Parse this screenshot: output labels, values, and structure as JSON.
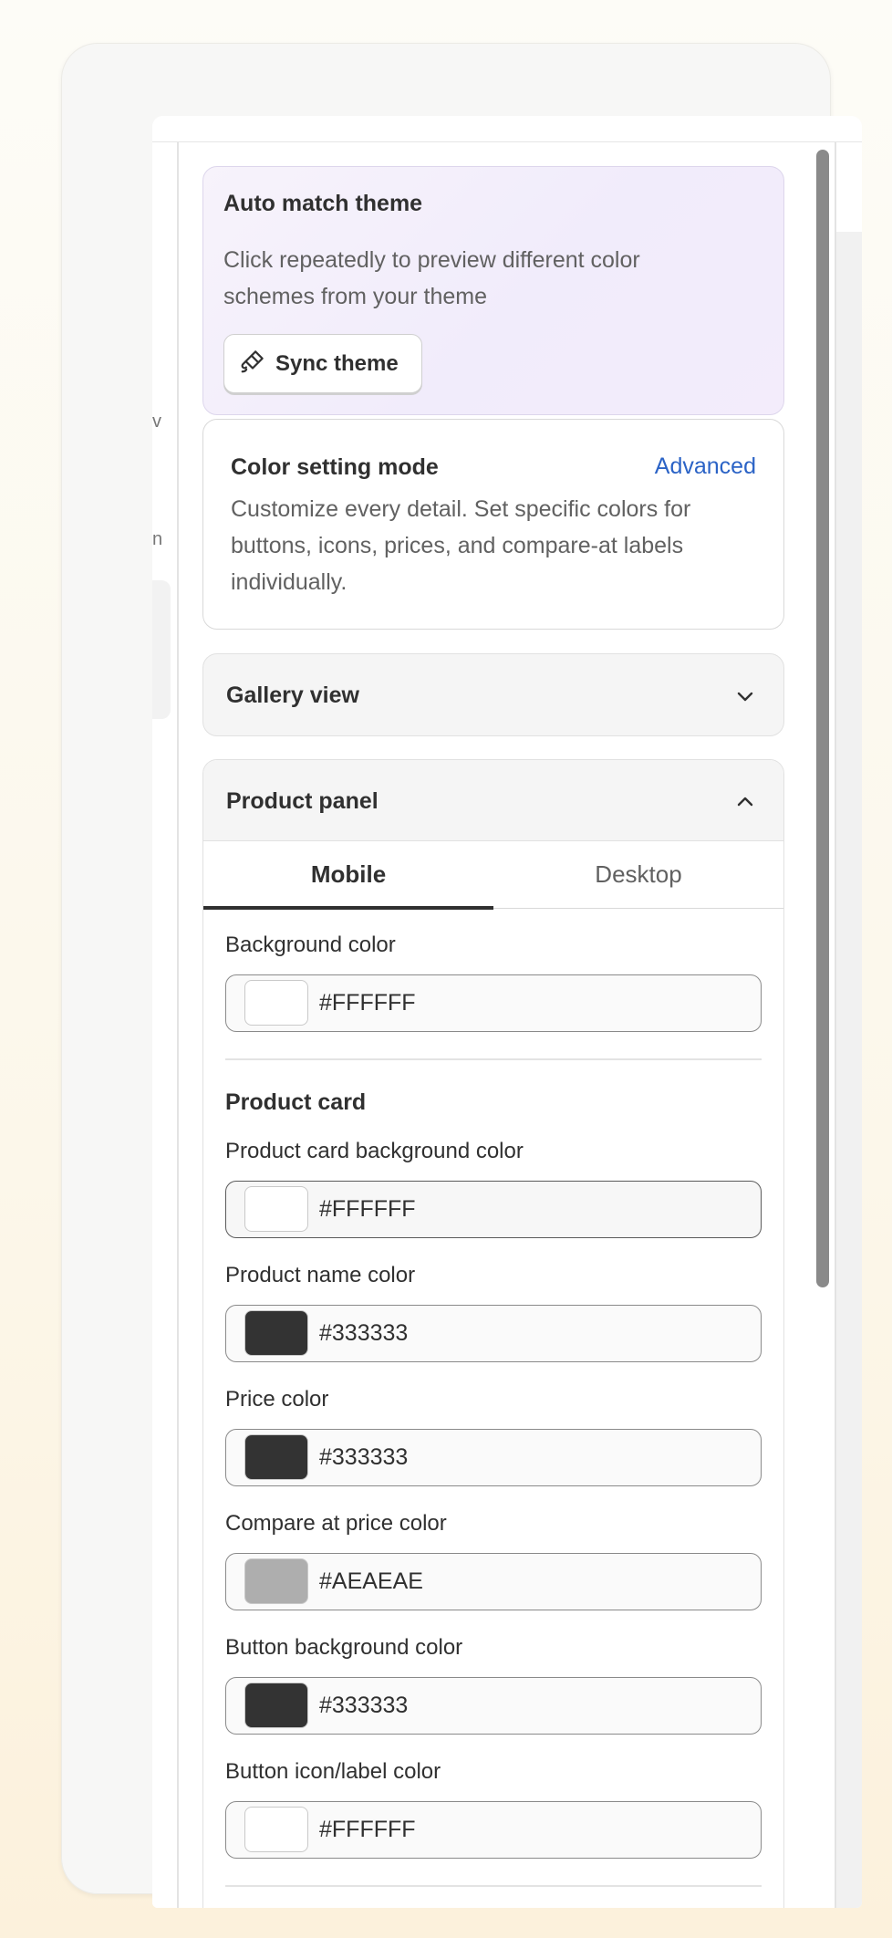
{
  "sidebar_fragments": {
    "item1": "v",
    "item2": "n"
  },
  "auto_match": {
    "title": "Auto match theme",
    "description": "Click repeatedly to preview different color schemes from your theme",
    "button_label": "Sync theme"
  },
  "color_mode": {
    "title": "Color setting mode",
    "link": "Advanced",
    "description": "Customize every detail. Set specific colors for buttons, icons, prices, and compare-at labels individually."
  },
  "gallery": {
    "title": "Gallery view",
    "expanded": false
  },
  "product_panel": {
    "title": "Product panel",
    "expanded": true,
    "tabs": {
      "mobile": "Mobile",
      "desktop": "Desktop",
      "active": "Mobile"
    },
    "background": {
      "label": "Background color",
      "value": "#FFFFFF"
    },
    "section_title": "Product card",
    "fields": {
      "card_bg": {
        "label": "Product card background color",
        "value": "#FFFFFF"
      },
      "name": {
        "label": "Product name color",
        "value": "#333333"
      },
      "price": {
        "label": "Price color",
        "value": "#333333"
      },
      "compare": {
        "label": "Compare at price color",
        "value": "#AEAEAE"
      },
      "btn_bg": {
        "label": "Button background color",
        "value": "#333333"
      },
      "btn_icon": {
        "label": "Button icon/label color",
        "value": "#FFFFFF"
      }
    }
  },
  "colors": {
    "link": "#2b63c6",
    "scroll_thumb": "#8a8a8a",
    "swatch_white": "#FFFFFF",
    "swatch_dark": "#333333",
    "swatch_gray": "#AEAEAE"
  }
}
